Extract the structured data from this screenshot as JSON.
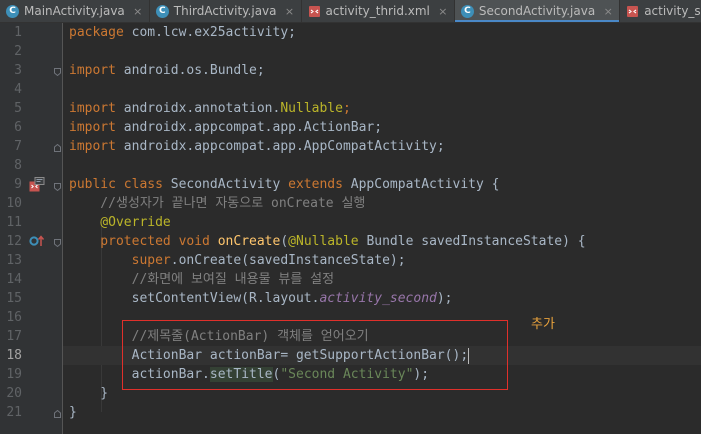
{
  "tabs": [
    {
      "label": "MainActivity.java",
      "icon": "class-icon",
      "active": false
    },
    {
      "label": "ThirdActivity.java",
      "icon": "class-icon",
      "active": false
    },
    {
      "label": "activity_thrid.xml",
      "icon": "xml-icon",
      "active": false
    },
    {
      "label": "SecondActivity.java",
      "icon": "class-icon",
      "active": true
    },
    {
      "label": "activity_second.xml",
      "icon": "xml-icon",
      "active": false
    }
  ],
  "close_glyph": "×",
  "line_numbers": [
    "1",
    "2",
    "3",
    "4",
    "5",
    "6",
    "7",
    "8",
    "9",
    "10",
    "11",
    "12",
    "13",
    "14",
    "15",
    "16",
    "17",
    "18",
    "19",
    "20",
    "21"
  ],
  "code": {
    "l1_kw": "package",
    "l1_rest": " com.lcw.ex25activity;",
    "l3_kw": "import",
    "l3_rest": " android.os.Bundle;",
    "l5_kw": "import",
    "l5_pre": " androidx.annotation.",
    "l5_ann": "Nullable",
    "l5_end": ";",
    "l6_kw": "import",
    "l6_rest": " androidx.appcompat.app.ActionBar;",
    "l7_kw": "import",
    "l7_rest": " androidx.appcompat.app.AppCompatActivity;",
    "l9_kw1": "public class",
    "l9_name": " SecondActivity ",
    "l9_kw2": "extends",
    "l9_rest": " AppCompatActivity {",
    "l10_cmt": "    //생성자가 끝나면 자동으로 onCreate 실행",
    "l11_ann": "    @Override",
    "l12_kw": "    protected void ",
    "l12_fn": "onCreate",
    "l12_p1": "(",
    "l12_ann": "@Nullable",
    "l12_rest": " Bundle savedInstanceState) {",
    "l13_kw": "        super",
    "l13_rest": ".onCreate(savedInstanceState);",
    "l14_cmt": "        //화면에 보여질 내용물 뷰를 설정",
    "l15_pre": "        setContentView(R.layout.",
    "l15_fld": "activity_second",
    "l15_end": ");",
    "l17_cmt": "        //제목줄(ActionBar) 객체를 얻어오기",
    "l18_code": "        ActionBar actionBar= getSupportActionBar();",
    "l19_pre": "        actionBar.",
    "l19_meth": "setTitle",
    "l19_p1": "(",
    "l19_str": "\"Second Activity\"",
    "l19_end": ");",
    "l20": "    }",
    "l21": "}"
  },
  "annotation_label": "추가",
  "colors": {
    "background": "#2b2b2b",
    "keyword": "#cc7832",
    "annotation": "#bbb529",
    "comment": "#808080",
    "string": "#6a8759",
    "field": "#9876aa",
    "method_decl": "#ffc66d",
    "highlight_box": "#e0302b",
    "added_label": "#e8a23c"
  }
}
